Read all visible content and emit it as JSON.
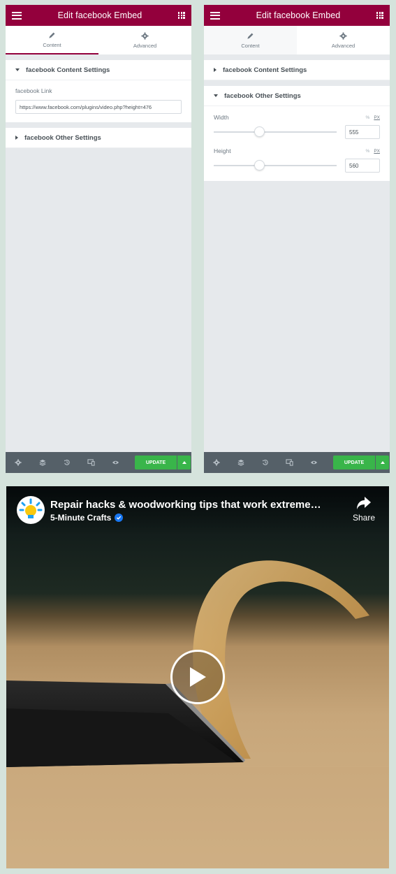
{
  "editor": {
    "title": "Edit facebook Embed",
    "tabs": [
      {
        "label": "Content",
        "icon": "pencil-icon"
      },
      {
        "label": "Advanced",
        "icon": "gear-icon"
      }
    ],
    "update_label": "UPDATE"
  },
  "left_panel": {
    "active_tab": "Content",
    "sections": {
      "content_settings": {
        "title": "facebook Content Settings",
        "expanded": true,
        "link_label": "facebook Link",
        "link_value": "https://www.facebook.com/plugins/video.php?height=476"
      },
      "other_settings": {
        "title": "facebook Other Settings",
        "expanded": false
      }
    }
  },
  "right_panel": {
    "sections": {
      "content_settings": {
        "title": "facebook Content Settings",
        "expanded": false
      },
      "other_settings": {
        "title": "facebook Other Settings",
        "expanded": true,
        "width": {
          "label": "Width",
          "unit_pct": "%",
          "unit_px": "PX",
          "value": "555",
          "slider_fraction": 0.37
        },
        "height": {
          "label": "Height",
          "unit_pct": "%",
          "unit_px": "PX",
          "value": "560",
          "slider_fraction": 0.37
        }
      }
    }
  },
  "video": {
    "title": "Repair hacks & woodworking tips that work extreme…",
    "channel": "5-Minute Crafts",
    "share_label": "Share"
  },
  "colors": {
    "brand": "#93003c",
    "update_green": "#39b54a",
    "bottombar": "#556068",
    "page_bg": "#d5e3dc"
  }
}
